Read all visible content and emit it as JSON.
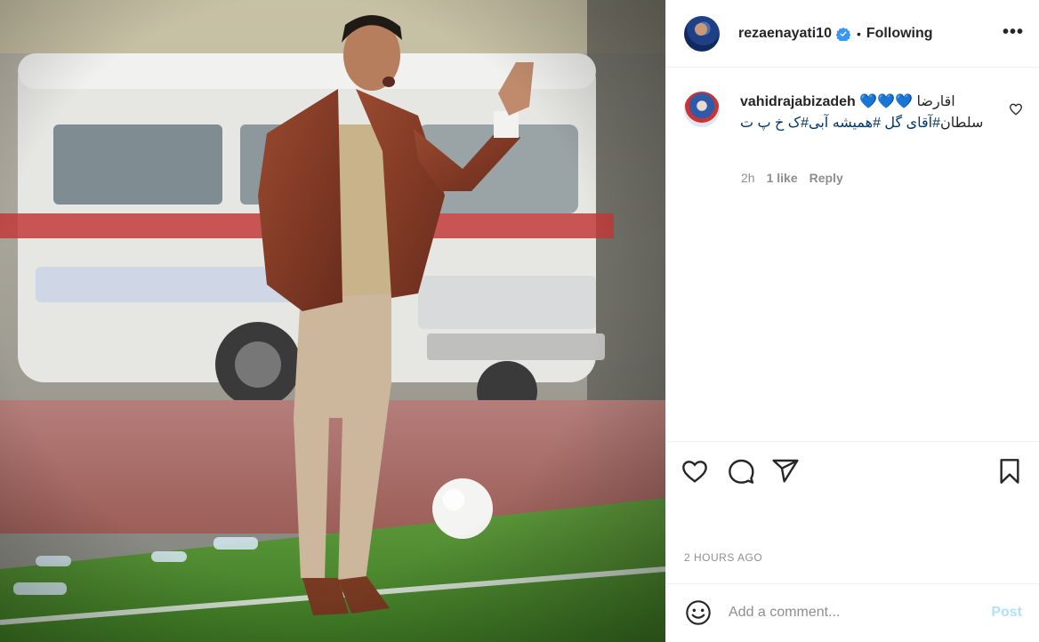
{
  "post": {
    "username": "rezaenayati10",
    "separator": "•",
    "follow_state": "Following",
    "more_label": "•••",
    "timestamp": "2 HOURS AGO"
  },
  "comment": {
    "username": "vahidrajabizadeh",
    "text_first": "اقارضا",
    "hearts": "💙💙💙",
    "text_rest": "سلطان",
    "hashtag1": "#آقای گل",
    "hashtag2": "#همیشه آبی",
    "hashtag3": "#ک خ پ ت",
    "age": "2h",
    "likes": "1 like",
    "reply_label": "Reply"
  },
  "add_comment": {
    "placeholder": "Add a comment...",
    "post_label": "Post"
  },
  "icons": {
    "verified": "verified-badge-icon",
    "like": "heart-icon",
    "comment": "comment-bubble-icon",
    "share": "paper-plane-icon",
    "save": "bookmark-icon",
    "emoji": "smiley-icon",
    "comment_like": "small-heart-icon"
  },
  "colors": {
    "verified_blue": "#3897f0",
    "hashtag": "#00376b",
    "post_disabled": "#b2dffc",
    "muted": "#8e8e8e"
  }
}
